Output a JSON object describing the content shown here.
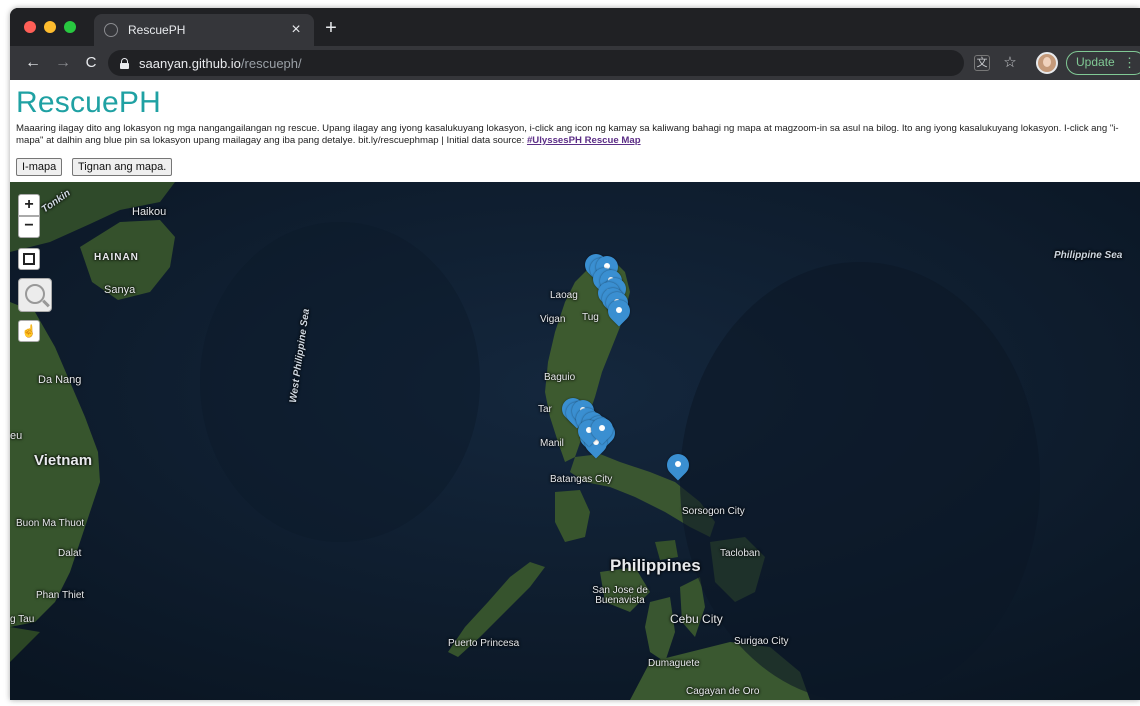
{
  "browser": {
    "tab_title": "RescuePH",
    "tab_close": "×",
    "new_tab": "+",
    "url_host": "saanyan.github.io",
    "url_path": "/rescueph/",
    "update_label": "Update",
    "update_menu": "⋮",
    "icons": [
      "back-arrow-icon",
      "forward-arrow-icon",
      "reload-icon",
      "lock-icon",
      "translate-icon",
      "star-icon",
      "avatar"
    ]
  },
  "page": {
    "title": "RescuePH",
    "instructions_text": "Maaaring ilagay dito ang lokasyon ng mga nangangailangan ng rescue. Upang ilagay ang iyong kasalukuyang lokasyon, i-click ang icon ng kamay sa kaliwang bahagi ng mapa at magzoom-in sa asul na bilog. Ito ang iyong kasalukuyang lokasyon. I-click ang \"i-mapa\" at dalhin ang blue pin sa lokasyon upang mailagay ang iba pang detalye. bit.ly/rescuephmap | Initial data source: ",
    "source_link": "#UlyssesPH Rescue Map",
    "button_map": "I-mapa",
    "button_view": "Tignan ang mapa."
  },
  "map": {
    "controls": {
      "zoom_in": "+",
      "zoom_out": "−",
      "locate": "☝"
    },
    "labels": {
      "tonkin": "Tonkin",
      "haikou": "Haikou",
      "hainan": "HAINAN",
      "sanya": "Sanya",
      "da_nang": "Da Nang",
      "hue": "eu",
      "vietnam": "Vietnam",
      "buon_ma_thuot": "Buon Ma Thuot",
      "dalat": "Dalat",
      "phan_thiet": "Phan Thiet",
      "vung_tau": "g Tau",
      "west_ph_sea": "West Philippine Sea",
      "ph_sea": "Philippine Sea",
      "laoag": "Laoag",
      "vigan": "Vigan",
      "tuguegarao": "Tug",
      "baguio": "Baguio",
      "tarlac": "Tar",
      "manila": "Manil",
      "batangas": "Batangas City",
      "sorsogon": "Sorsogon City",
      "philippines": "Philippines",
      "tacloban": "Tacloban",
      "san_jose": "San Jose de Buenavista",
      "cebu": "Cebu City",
      "surigao": "Surigao City",
      "puerto_princesa": "Puerto Princesa",
      "dumaguete": "Dumaguete",
      "cagayan": "Cagayan de Oro"
    },
    "pin_count": 22
  }
}
